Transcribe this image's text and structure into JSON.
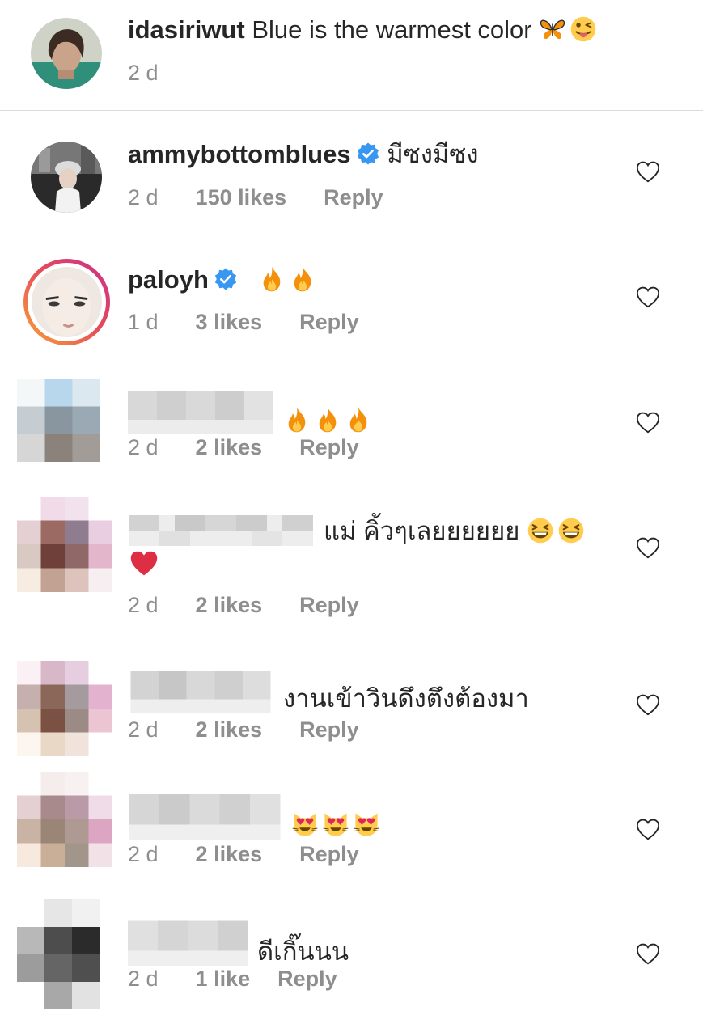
{
  "caption": {
    "username": "idasiriwut",
    "text": "Blue is the warmest color",
    "time": "2 d",
    "emojis": [
      "butterfly-emoji",
      "winking-tongue-emoji"
    ]
  },
  "comments": [
    {
      "username": "ammybottomblues",
      "verified": true,
      "text": "มีซงมีซง",
      "time": "2 d",
      "likes": "150 likes",
      "reply": "Reply"
    },
    {
      "username": "paloyh",
      "verified": true,
      "text": "",
      "emojis": [
        "fire-emoji",
        "fire-emoji"
      ],
      "time": "1 d",
      "likes": "3 likes",
      "reply": "Reply"
    },
    {
      "username": "",
      "text": "",
      "emojis": [
        "fire-emoji",
        "fire-emoji",
        "fire-emoji"
      ],
      "time": "2 d",
      "likes": "2 likes",
      "reply": "Reply"
    },
    {
      "username": "",
      "text": "แม่ คิ้วๆเลยยยยยย",
      "emojis": [
        "grinning-squinting-emoji",
        "grinning-squinting-emoji",
        "red-heart-emoji"
      ],
      "time": "2 d",
      "likes": "2 likes",
      "reply": "Reply"
    },
    {
      "username": "",
      "text": "งานเข้าวินดึงตึงต้องมา",
      "time": "2 d",
      "likes": "2 likes",
      "reply": "Reply"
    },
    {
      "username": "",
      "text": "",
      "emojis": [
        "heart-eyes-cat-emoji",
        "heart-eyes-cat-emoji",
        "heart-eyes-cat-emoji"
      ],
      "time": "2 d",
      "likes": "2 likes",
      "reply": "Reply"
    },
    {
      "username": "",
      "text": "ดีเกิ๊นนน",
      "time": "2 d",
      "likes": "1 like",
      "reply": "Reply"
    }
  ],
  "colors": {
    "text": "#262626",
    "meta": "#8e8e8e",
    "verified": "#3897f0",
    "divider": "#dbdbdb",
    "story_ring_start": "#f9a33a",
    "story_ring_end": "#c82f8f"
  }
}
